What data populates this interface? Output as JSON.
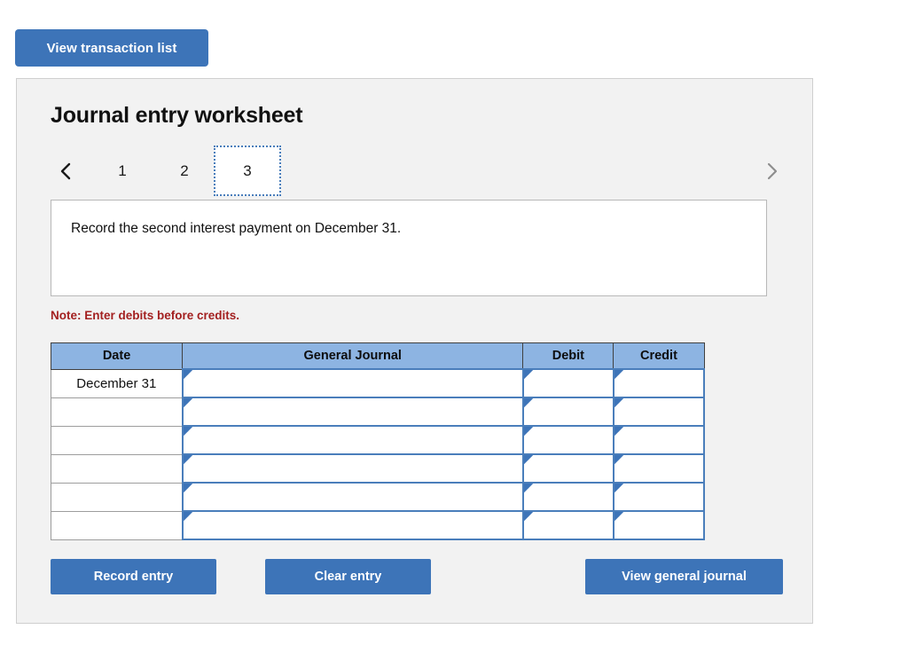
{
  "toolbar": {
    "view_transaction_list_label": "View transaction list"
  },
  "panel": {
    "title": "Journal entry worksheet",
    "pager": {
      "prev_icon": "chevron-left-icon",
      "next_icon": "chevron-right-icon",
      "tabs": [
        {
          "label": "1",
          "active": false
        },
        {
          "label": "2",
          "active": false
        },
        {
          "label": "3",
          "active": true
        }
      ]
    },
    "instruction": "Record the second interest payment on December 31.",
    "note": "Note: Enter debits before credits."
  },
  "table": {
    "columns": [
      "Date",
      "General Journal",
      "Debit",
      "Credit"
    ],
    "rows": [
      {
        "date": "December 31",
        "general_journal": "",
        "debit": "",
        "credit": ""
      },
      {
        "date": "",
        "general_journal": "",
        "debit": "",
        "credit": ""
      },
      {
        "date": "",
        "general_journal": "",
        "debit": "",
        "credit": ""
      },
      {
        "date": "",
        "general_journal": "",
        "debit": "",
        "credit": ""
      },
      {
        "date": "",
        "general_journal": "",
        "debit": "",
        "credit": ""
      },
      {
        "date": "",
        "general_journal": "",
        "debit": "",
        "credit": ""
      }
    ]
  },
  "actions": {
    "record_entry_label": "Record entry",
    "clear_entry_label": "Clear entry",
    "view_general_journal_label": "View general journal"
  },
  "colors": {
    "button_blue": "#3d74b8",
    "header_blue": "#8db4e2",
    "cell_border_blue": "#4a7ebb",
    "note_red": "#a32020",
    "panel_gray": "#f2f2f2"
  }
}
